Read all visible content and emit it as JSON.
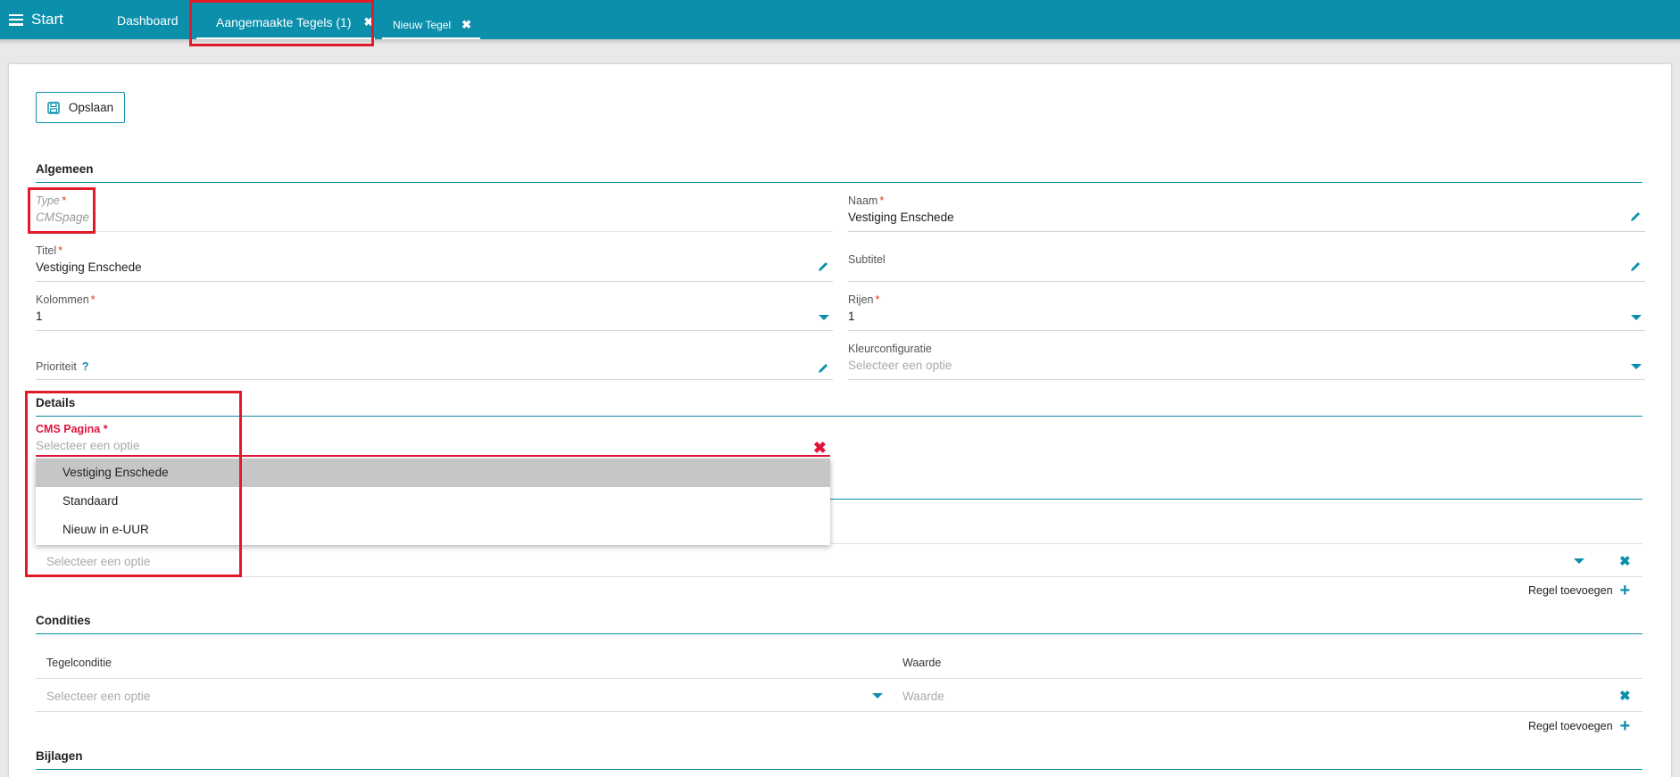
{
  "topbar": {
    "start_label": "Start",
    "tabs": [
      {
        "label": "Dashboard"
      },
      {
        "label": "Aangemaakte Tegels (1)"
      },
      {
        "label": "Nieuw Tegel"
      }
    ],
    "close_glyph": "✖"
  },
  "toolbar": {
    "save_label": "Opslaan",
    "save_icon": "floppy-disk-icon"
  },
  "sections": {
    "algemeen": "Algemeen",
    "details": "Details",
    "condities": "Condities",
    "bijlagen": "Bijlagen"
  },
  "fields": {
    "type": {
      "label": "Type",
      "value": "CMSpage"
    },
    "naam": {
      "label": "Naam",
      "value": "Vestiging Enschede"
    },
    "titel": {
      "label": "Titel",
      "value": "Vestiging Enschede"
    },
    "subtitel": {
      "label": "Subtitel",
      "value": ""
    },
    "kolommen": {
      "label": "Kolommen",
      "value": "1"
    },
    "rijen": {
      "label": "Rijen",
      "value": "1"
    },
    "prioriteit": {
      "label": "Prioriteit",
      "help": "?"
    },
    "kleur": {
      "label": "Kleurconfiguratie",
      "placeholder": "Selecteer een optie"
    }
  },
  "required_mark": "*",
  "cms": {
    "label": "CMS Pagina",
    "placeholder": "Selecteer een optie",
    "options": [
      "Vestiging Enschede",
      "Standaard",
      "Nieuw in e-UUR"
    ],
    "selected_index": 0
  },
  "details_row": {
    "placeholder": "Selecteer een optie"
  },
  "add_rule_label": "Regel toevoegen",
  "condities": {
    "col_condition": "Tegelconditie",
    "col_value": "Waarde",
    "condition_placeholder": "Selecteer een optie",
    "value_placeholder": "Waarde"
  },
  "colors": {
    "accent": "#0b8fab",
    "error": "#e0143c",
    "highlight_box": "#e11b2b"
  }
}
